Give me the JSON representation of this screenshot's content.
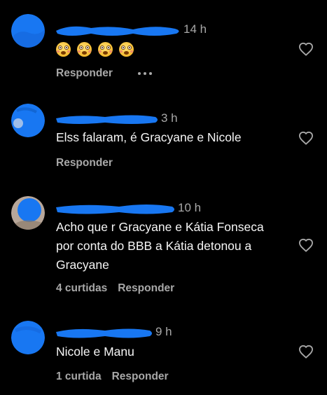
{
  "comments": [
    {
      "time": "14 h",
      "text": "",
      "emoji_count": 4,
      "likes": "",
      "reply": "Responder",
      "has_more_menu": true
    },
    {
      "time": "3 h",
      "text": "Elss falaram, é Gracyane e Nicole",
      "likes": "",
      "reply": "Responder"
    },
    {
      "time": "10 h",
      "text": "Acho que r Gracyane e Kátia Fonseca por conta do BBB a Kátia detonou a Gracyane",
      "likes": "4 curtidas",
      "reply": "Responder"
    },
    {
      "time": "9 h",
      "text": "Nicole e Manu",
      "likes": "1 curtida",
      "reply": "Responder"
    }
  ],
  "colors": {
    "background": "#000000",
    "text": "#f5f5f5",
    "secondary": "#a8a8a8",
    "blur": "#1877f2"
  },
  "icons": {
    "like": "heart-outline-icon",
    "more": "more-dots-icon",
    "emoji": "flushed-face-emoji"
  }
}
